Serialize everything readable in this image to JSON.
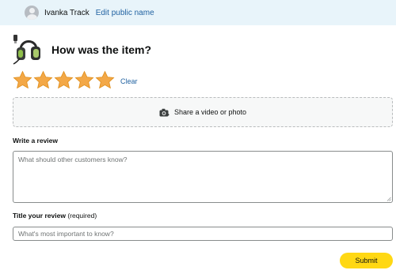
{
  "header": {
    "user_name": "Ivanka Track",
    "edit_link": "Edit public name"
  },
  "product": {
    "question": "How was the item?",
    "image_icon": "headset-product-image"
  },
  "rating": {
    "value": 5,
    "max": 5,
    "clear_label": "Clear",
    "star_color": "#f3a847"
  },
  "media": {
    "label": "Share a video or photo",
    "icon": "camera-icon"
  },
  "review": {
    "label": "Write a review",
    "placeholder": "What should other customers know?"
  },
  "title_field": {
    "label": "Title your review",
    "label_note": "(required)",
    "placeholder": "What's most important to know?"
  },
  "submit": {
    "label": "Submit",
    "color": "#ffd814"
  }
}
